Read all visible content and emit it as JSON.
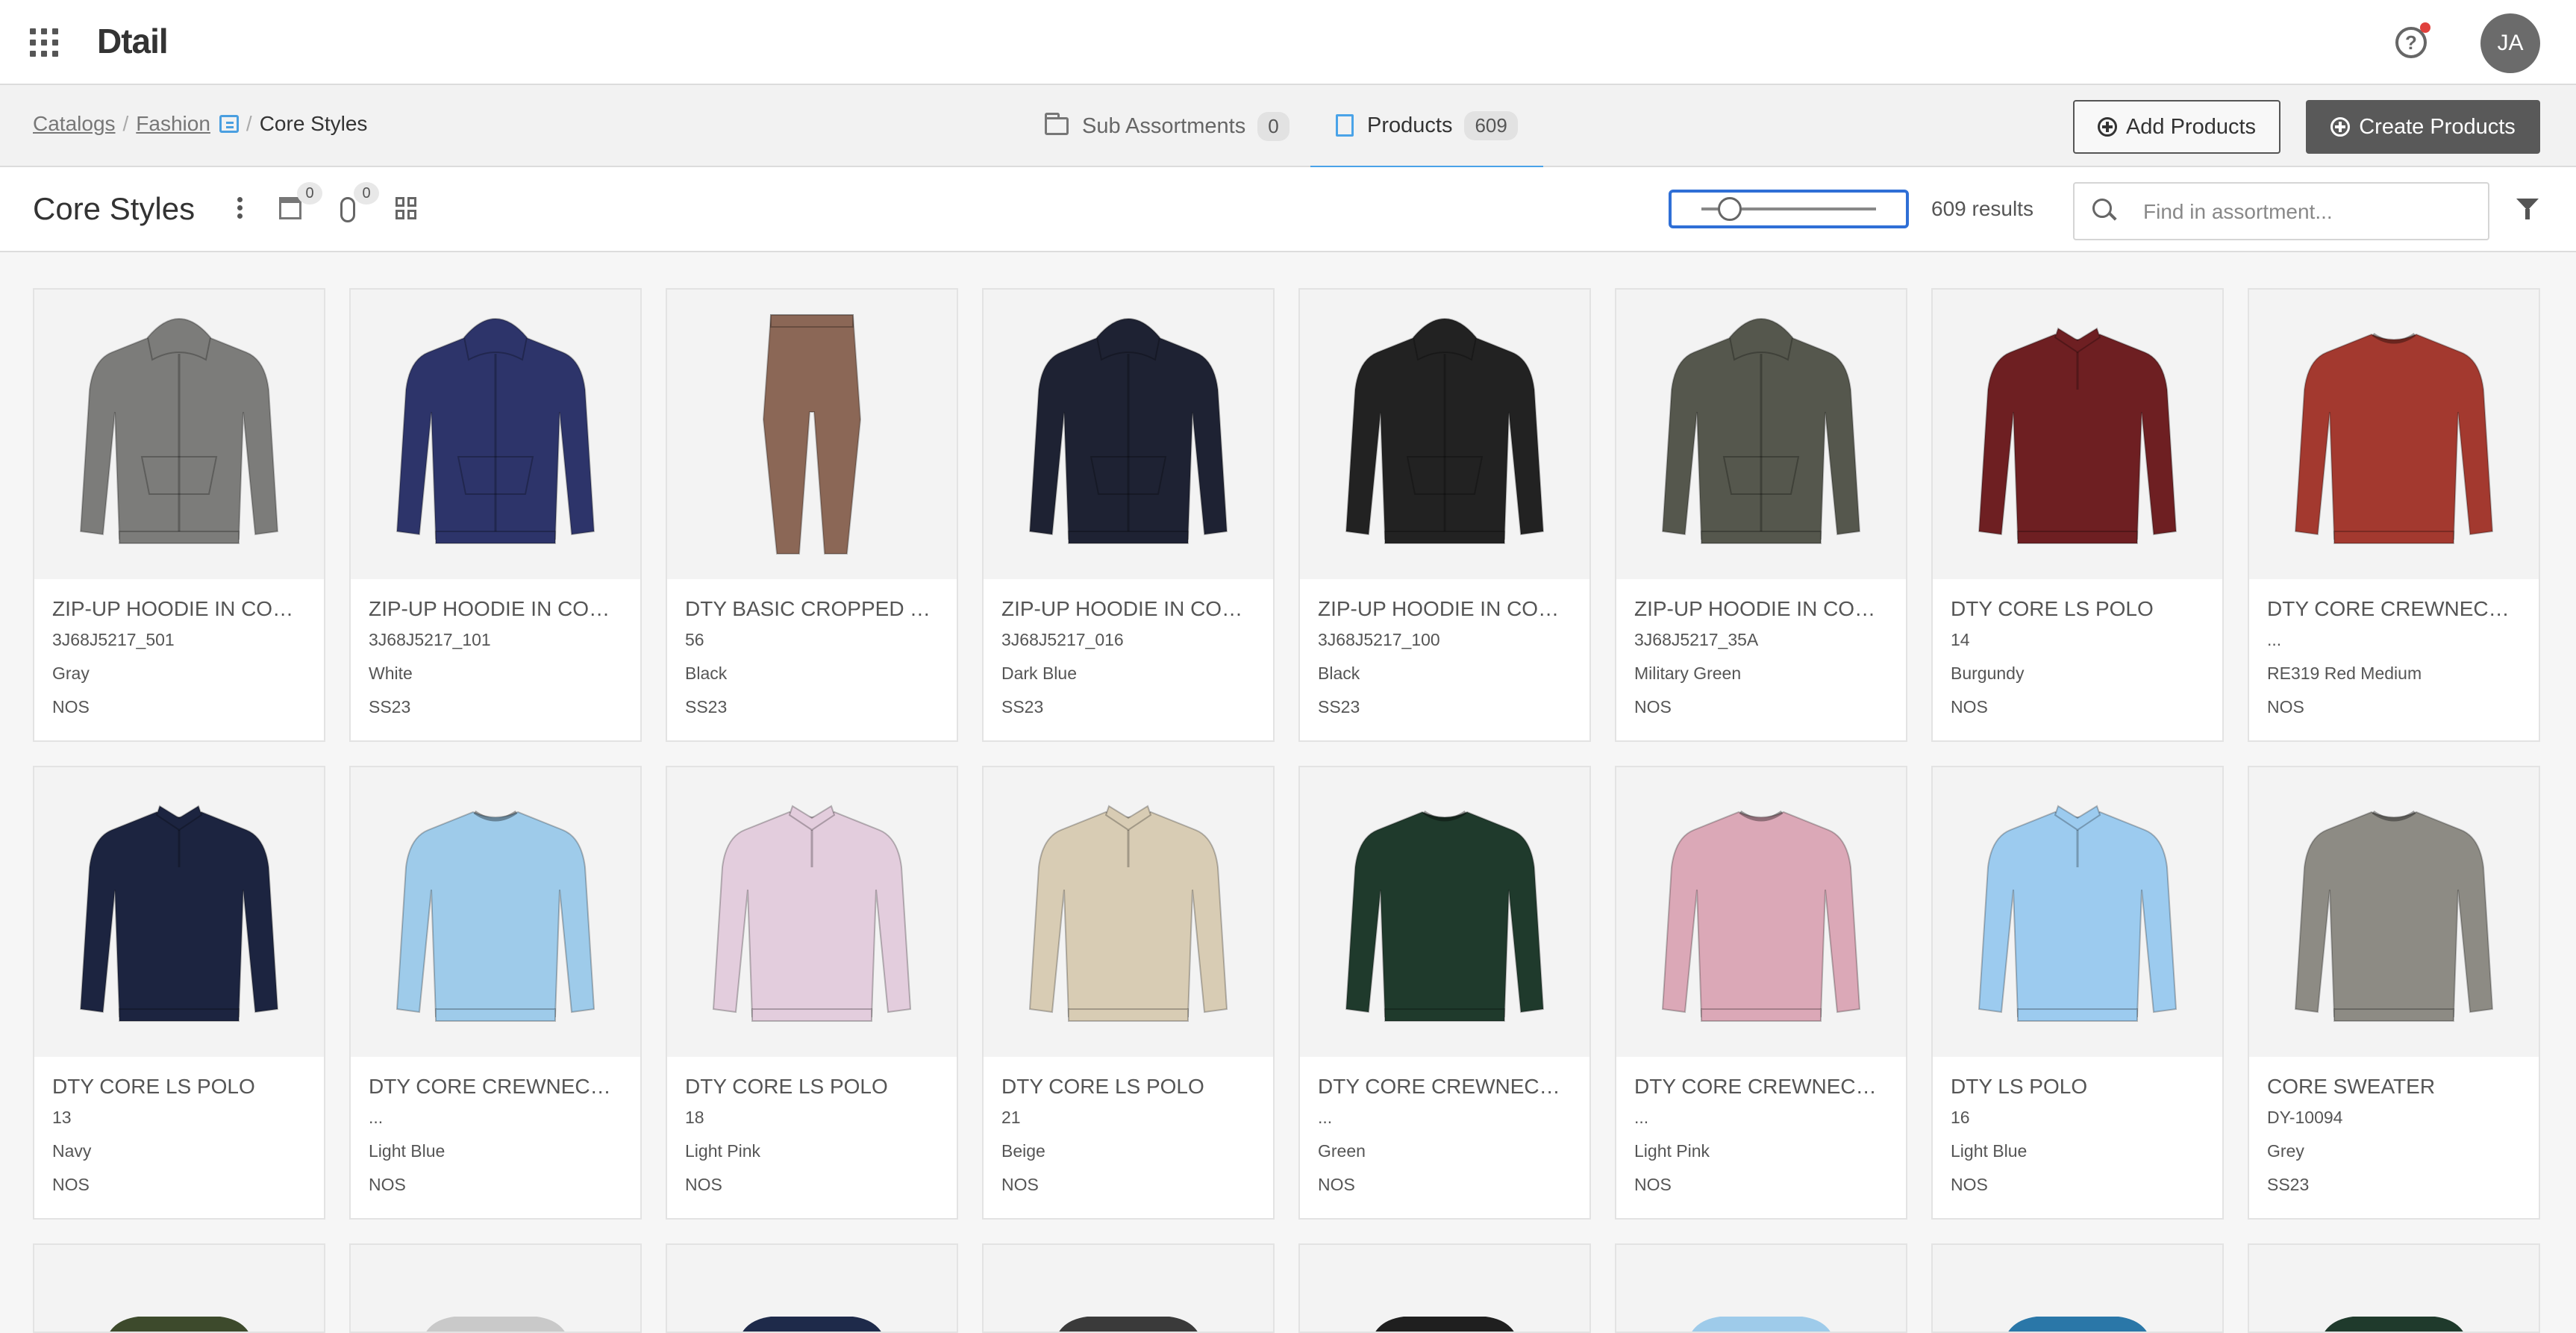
{
  "app": {
    "logo": "Dtail",
    "avatar_initials": "JA"
  },
  "breadcrumb": {
    "items": [
      "Catalogs",
      "Fashion"
    ],
    "current": "Core Styles"
  },
  "tabs": [
    {
      "label": "Sub Assortments",
      "count": "0",
      "icon": "folder-icon"
    },
    {
      "label": "Products",
      "count": "609",
      "icon": "document-icon",
      "active": true
    }
  ],
  "actions": {
    "add_products": "Add Products",
    "create_products": "Create Products"
  },
  "header": {
    "title": "Core Styles",
    "store_badge": "0",
    "attach_badge": "0",
    "results": "609 results",
    "search_placeholder": "Find in assortment...",
    "zoom_fraction": 0.15
  },
  "products": [
    {
      "name": "ZIP-UP HOODIE IN COTT...",
      "code": "3J68J5217_501",
      "color": "Gray",
      "season": "NOS",
      "garment": "hoodie",
      "fill": "#7c7c7a"
    },
    {
      "name": "ZIP-UP HOODIE IN COTT...",
      "code": "3J68J5217_101",
      "color": "White",
      "season": "SS23",
      "garment": "hoodie",
      "fill": "#2d346a"
    },
    {
      "name": "DTY BASIC CROPPED TI...",
      "code": "56",
      "color": "Black",
      "season": "SS23",
      "garment": "pants",
      "fill": "#8b6756"
    },
    {
      "name": "ZIP-UP HOODIE IN COTT...",
      "code": "3J68J5217_016",
      "color": "Dark Blue",
      "season": "SS23",
      "garment": "hoodie",
      "fill": "#1e2233"
    },
    {
      "name": "ZIP-UP HOODIE IN COTT...",
      "code": "3J68J5217_100",
      "color": "Black",
      "season": "SS23",
      "garment": "hoodie",
      "fill": "#222222"
    },
    {
      "name": "ZIP-UP HOODIE IN COTT...",
      "code": "3J68J5217_35A",
      "color": "Military Green",
      "season": "NOS",
      "garment": "hoodie",
      "fill": "#55574d"
    },
    {
      "name": "DTY CORE LS POLO",
      "code": "14",
      "color": "Burgundy",
      "season": "NOS",
      "garment": "polo",
      "fill": "#6e1f22"
    },
    {
      "name": "DTY CORE CREWNECK S...",
      "code": "...",
      "color": "RE319 Red Medium",
      "season": "NOS",
      "garment": "crew",
      "fill": "#a3392f"
    },
    {
      "name": "DTY CORE LS POLO",
      "code": "13",
      "color": "Navy",
      "season": "NOS",
      "garment": "polo",
      "fill": "#1c2440"
    },
    {
      "name": "DTY CORE CREWNECK S...",
      "code": "...",
      "color": "Light Blue",
      "season": "NOS",
      "garment": "crew",
      "fill": "#9ecbea"
    },
    {
      "name": "DTY CORE LS POLO",
      "code": "18",
      "color": "Light Pink",
      "season": "NOS",
      "garment": "polo",
      "fill": "#e3cddd"
    },
    {
      "name": "DTY CORE LS POLO",
      "code": "21",
      "color": "Beige",
      "season": "NOS",
      "garment": "polo",
      "fill": "#d8ccb4"
    },
    {
      "name": "DTY CORE CREWNECK S...",
      "code": "...",
      "color": "Green",
      "season": "NOS",
      "garment": "crew",
      "fill": "#1f3a2c"
    },
    {
      "name": "DTY CORE CREWNECK S...",
      "code": "...",
      "color": "Light Pink",
      "season": "NOS",
      "garment": "crew",
      "fill": "#dba8b7"
    },
    {
      "name": "DTY LS POLO",
      "code": "16",
      "color": "Light Blue",
      "season": "NOS",
      "garment": "polo",
      "fill": "#9ccbef"
    },
    {
      "name": "CORE SWEATER",
      "code": "DY-10094",
      "color": "Grey",
      "season": "SS23",
      "garment": "crew",
      "fill": "#8d8b84"
    }
  ],
  "partial_row_fills": [
    "#3d4a2c",
    "#c9c9c9",
    "#1e2a4a",
    "#3a3a3a",
    "#1f1f1f",
    "#9ecbea",
    "#2a77a8",
    "#1f3a2c"
  ]
}
